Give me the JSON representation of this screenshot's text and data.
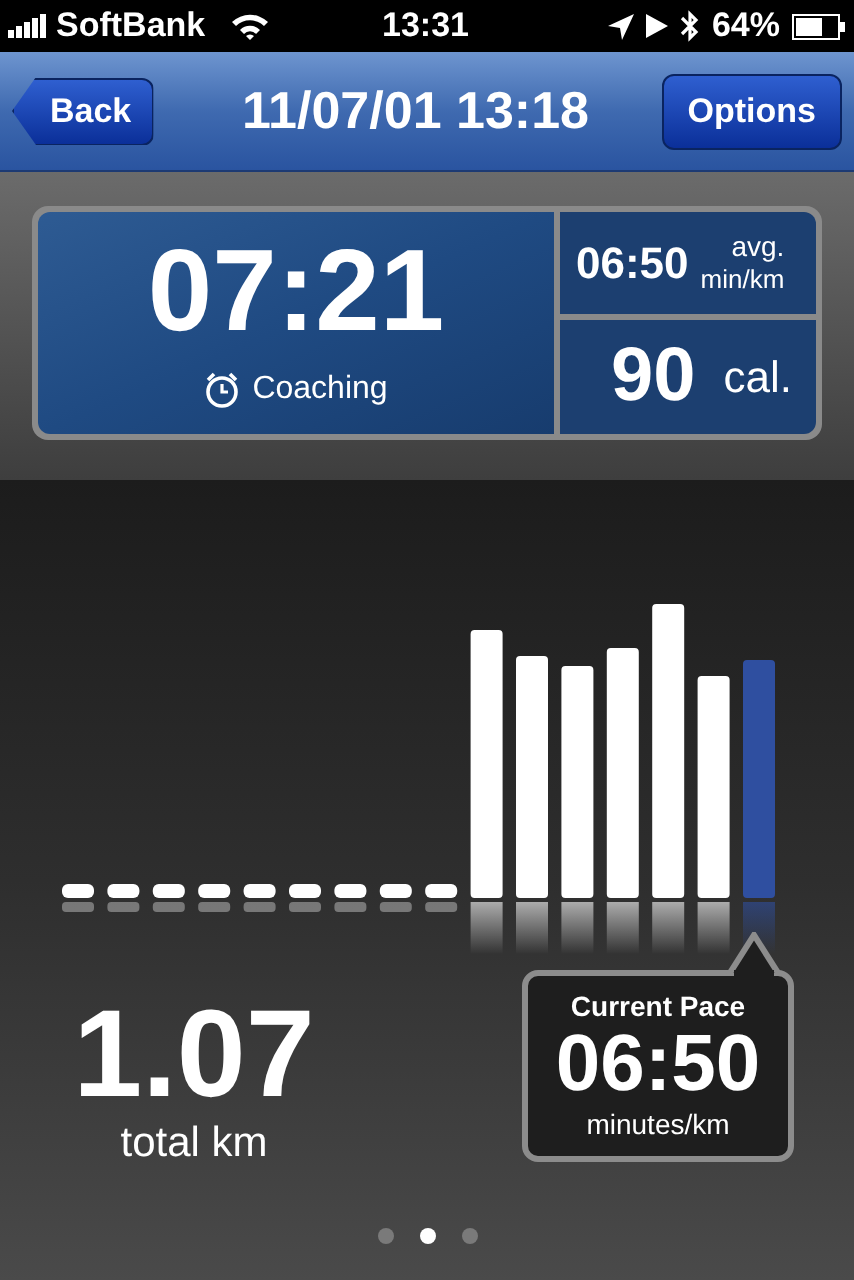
{
  "status_bar": {
    "carrier": "SoftBank",
    "time": "13:31",
    "battery": "64%"
  },
  "nav_bar": {
    "back": "Back",
    "title": "11/07/01 13:18",
    "options": "Options"
  },
  "summary": {
    "duration": "07:21",
    "coaching": "Coaching",
    "avg_pace": "06:50",
    "avg_label": "avg.",
    "avg_unit": "min/km",
    "calories": "90",
    "calories_unit": "cal."
  },
  "distance": {
    "value": "1.07",
    "label": "total km"
  },
  "current_pace": {
    "title": "Current Pace",
    "value": "06:50",
    "unit": "minutes/km"
  },
  "page_dots": [
    {
      "selected": false
    },
    {
      "selected": true
    },
    {
      "selected": false
    }
  ]
}
